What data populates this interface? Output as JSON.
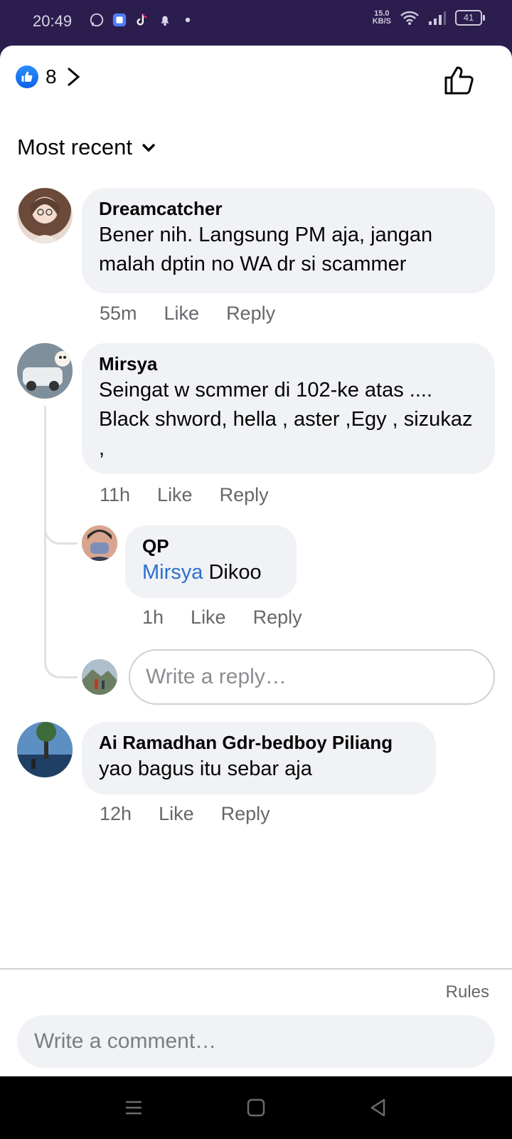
{
  "status_bar": {
    "time": "20:49",
    "net_speed_value": "15.0",
    "net_speed_unit": "KB/S",
    "battery": "41",
    "icons": [
      "whatsapp-icon",
      "app-icon",
      "tiktok-icon",
      "notification-bell-icon",
      "dot-icon",
      "wifi-icon",
      "signal-icon",
      "battery-icon"
    ]
  },
  "header": {
    "like_count": "8",
    "icons": [
      "like-badge-icon",
      "chevron-right-icon",
      "thumbs-up-icon"
    ]
  },
  "sort": {
    "label": "Most recent"
  },
  "comments": [
    {
      "author": "Dreamcatcher",
      "text": "Bener nih. Langsung PM aja, jangan malah dptin no WA dr si scammer",
      "time": "55m",
      "like": "Like",
      "reply": "Reply"
    },
    {
      "author": "Mirsya",
      "text": "Seingat w scmmer di 102-ke atas .... Black shword, hella , aster ,Egy , sizukaz ,",
      "time": "11h",
      "like": "Like",
      "reply": "Reply",
      "replies": [
        {
          "author": "QP",
          "mention": "Mirsya",
          "text": "Dikoo",
          "time": "1h",
          "like": "Like",
          "reply": "Reply"
        }
      ],
      "reply_placeholder": "Write a reply…"
    },
    {
      "author": "Ai Ramadhan Gdr-bedboy Piliang",
      "text": "yao bagus itu sebar aja",
      "time": "12h",
      "like": "Like",
      "reply": "Reply"
    }
  ],
  "footer": {
    "rules": "Rules",
    "comment_placeholder": "Write a comment…"
  },
  "colors": {
    "status_bar_bg": "#2b1d4e",
    "bubble_bg": "#f0f2f5",
    "link": "#2d6fcf",
    "like_blue": "#1877f2"
  }
}
